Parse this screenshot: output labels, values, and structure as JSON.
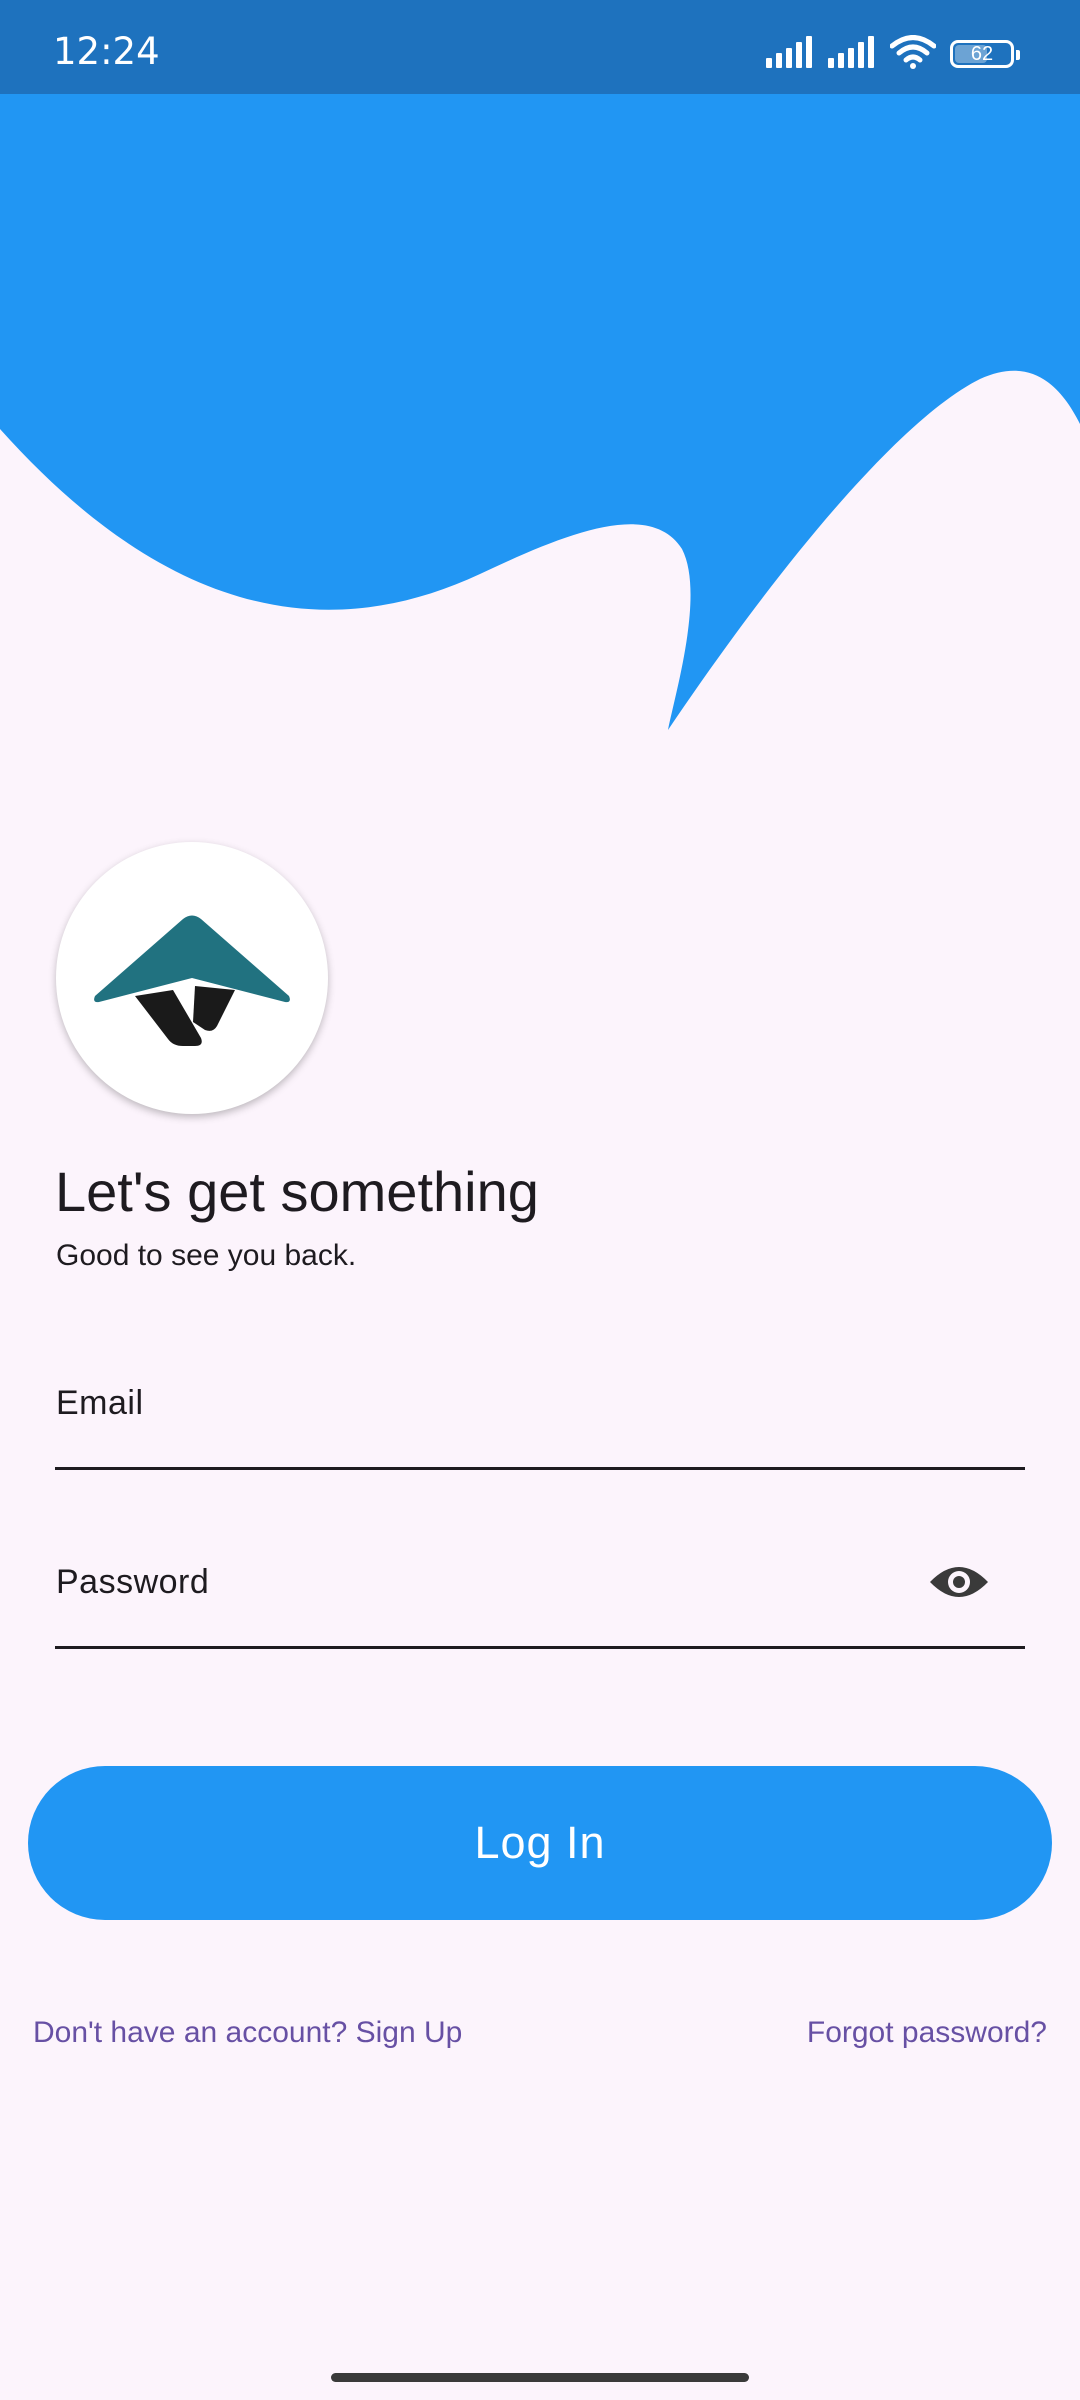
{
  "status_bar": {
    "time": "12:24",
    "battery_level": "62",
    "icons": [
      "signal-icon",
      "signal-icon",
      "wifi-icon",
      "battery-icon"
    ]
  },
  "colors": {
    "brand_blue": "#2196F3",
    "status_bar": "#1E72BE",
    "background": "#FCF4FC",
    "link": "#6750A4",
    "logo_teal": "#217280"
  },
  "logo": {
    "icon": "umbrella-logo-icon"
  },
  "header": {
    "title": "Let's get something",
    "subtitle": "Good to see you back."
  },
  "form": {
    "email_label": "Email",
    "password_label": "Password",
    "password_visibility_icon": "eye-icon"
  },
  "actions": {
    "login_label": "Log In",
    "signup_link": "Don't have an account? Sign Up",
    "forgot_link": "Forgot password?"
  }
}
